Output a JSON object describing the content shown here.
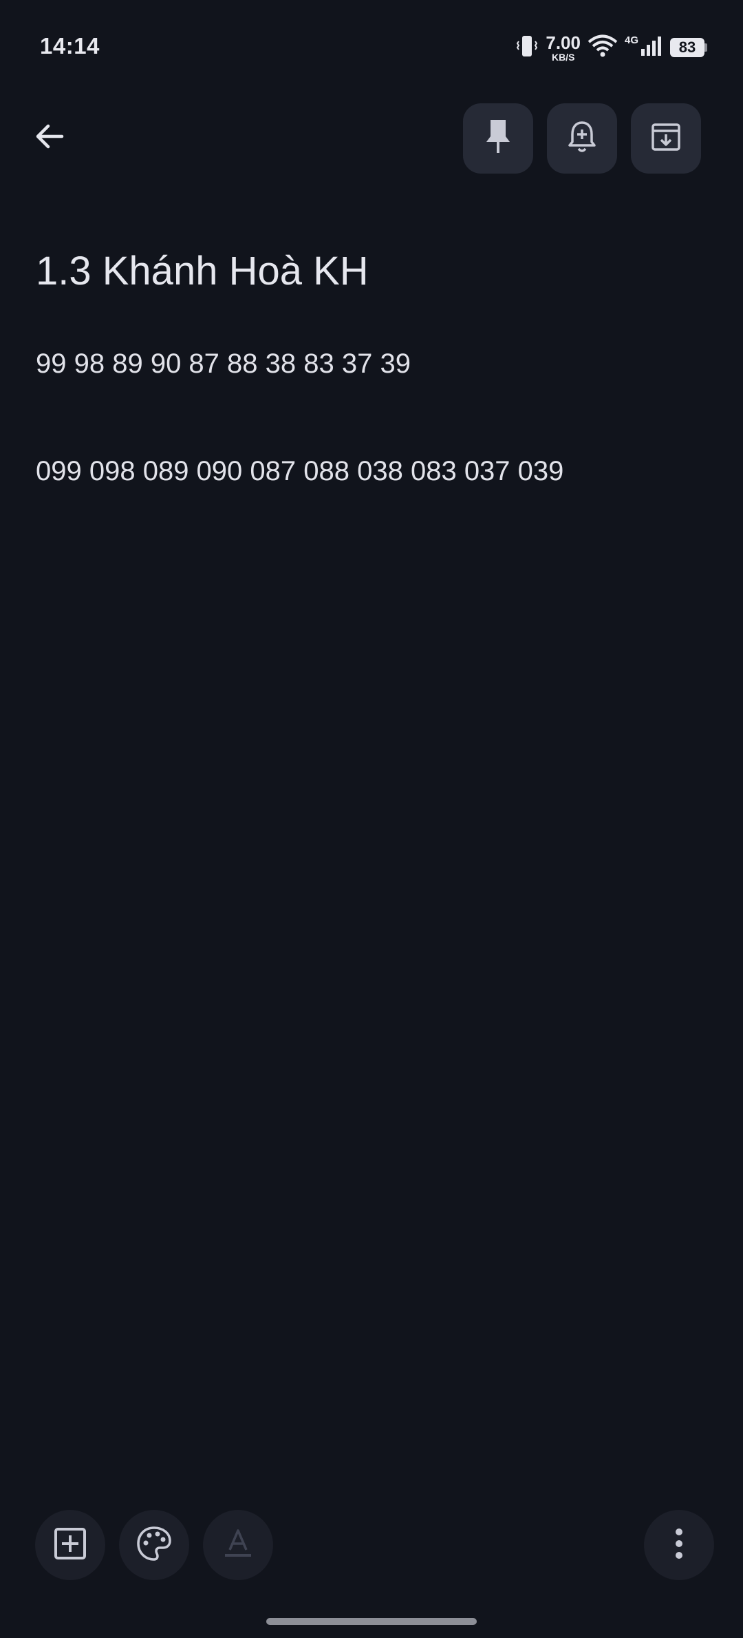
{
  "status_bar": {
    "time": "14:14",
    "speed_value": "7.00",
    "speed_unit": "KB/S",
    "network_type": "4G",
    "battery_level": "83"
  },
  "toolbar": {
    "back_icon": "arrow-left-icon",
    "pin_icon": "pin-icon",
    "reminder_icon": "bell-plus-icon",
    "archive_icon": "archive-icon"
  },
  "note": {
    "title": "1.3 Khánh Hoà KH",
    "lines": [
      "99 98 89 90 87 88 38 83 37 39",
      "099 098 089 090 087 088 038 083 037 039"
    ]
  },
  "bottom_bar": {
    "add_icon": "add-box-icon",
    "palette_icon": "palette-icon",
    "format_icon": "text-format-icon",
    "more_icon": "more-vertical-icon"
  },
  "colors": {
    "background": "#11141c",
    "button_bg": "#262a36",
    "icon": "#c9cbd6"
  }
}
